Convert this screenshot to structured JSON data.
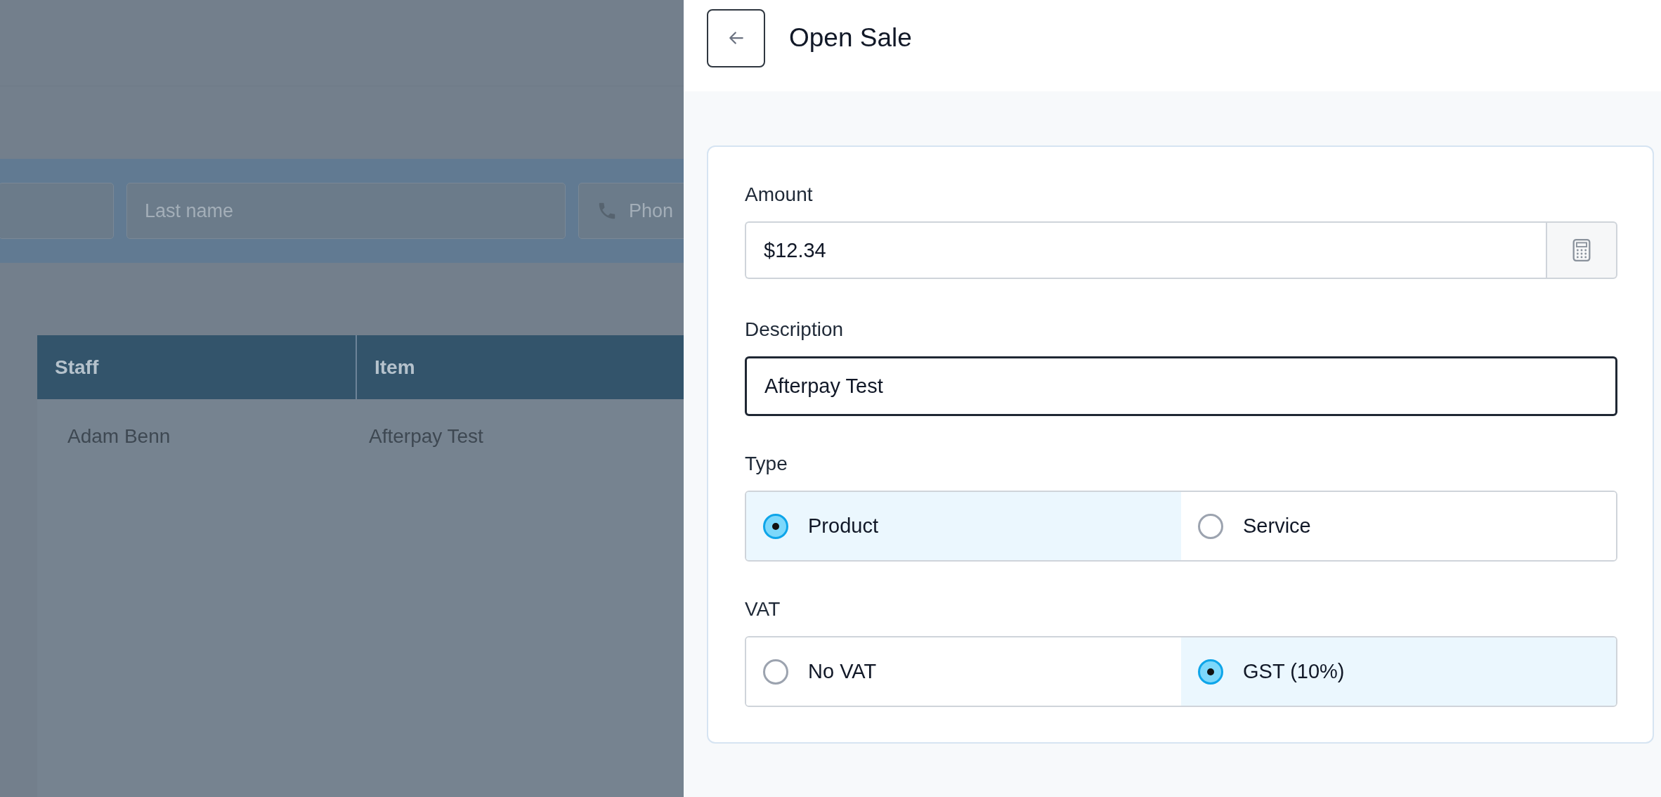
{
  "background": {
    "search_fields": [
      {
        "kind": "text"
      },
      {
        "kind": "text",
        "placeholder": "Last name"
      },
      {
        "kind": "phone",
        "placeholder": "Phon"
      }
    ],
    "table": {
      "columns": [
        "Staff",
        "Item"
      ],
      "rows": [
        [
          "Adam Benn",
          "Afterpay Test"
        ]
      ]
    }
  },
  "panel": {
    "title": "Open Sale",
    "amount": {
      "label": "Amount",
      "value": "$12.34"
    },
    "description": {
      "label": "Description",
      "value": "Afterpay Test",
      "focused": true
    },
    "type": {
      "label": "Type",
      "options": [
        {
          "label": "Product",
          "selected": true
        },
        {
          "label": "Service",
          "selected": false
        }
      ]
    },
    "vat": {
      "label": "VAT",
      "options": [
        {
          "label": "No VAT",
          "selected": false
        },
        {
          "label": "GST (10%)",
          "selected": true
        }
      ]
    }
  }
}
